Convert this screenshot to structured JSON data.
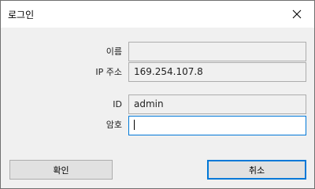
{
  "window": {
    "title": "로그인",
    "close_glyph": "✕",
    "close_icon": "close-icon"
  },
  "form": {
    "name": {
      "label": "이름",
      "value": ""
    },
    "ip": {
      "label": "IP 주소",
      "value": "169.254.107.8"
    },
    "id": {
      "label": "ID",
      "value": "admin"
    },
    "password": {
      "label": "암호",
      "value": ""
    }
  },
  "buttons": {
    "ok": "확인",
    "cancel": "취소"
  },
  "colors": {
    "focus_border": "#0078d7",
    "dialog_background": "#f0f0f0",
    "readonly_field_border": "#adadad"
  }
}
